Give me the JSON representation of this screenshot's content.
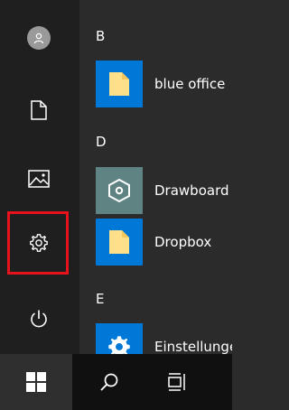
{
  "sidebar": {
    "items": [
      {
        "name": "account",
        "icon": "user-icon"
      },
      {
        "name": "documents",
        "icon": "document-icon"
      },
      {
        "name": "pictures",
        "icon": "pictures-icon"
      },
      {
        "name": "settings",
        "icon": "gear-icon",
        "highlighted": true
      },
      {
        "name": "power",
        "icon": "power-icon"
      }
    ]
  },
  "app_list": {
    "groups": [
      {
        "letter": "B",
        "apps": [
          {
            "label": "blue office",
            "icon": "folder-icon",
            "tile_color": "#0078d7"
          }
        ]
      },
      {
        "letter": "D",
        "apps": [
          {
            "label": "Drawboard",
            "icon": "drawboard-icon",
            "tile_color": "#5f8383"
          },
          {
            "label": "Dropbox",
            "icon": "folder-icon",
            "tile_color": "#0078d7"
          }
        ]
      },
      {
        "letter": "E",
        "apps": [
          {
            "label": "Einstellungen",
            "icon": "gear-icon",
            "tile_color": "#0078d7"
          }
        ]
      }
    ]
  },
  "taskbar": {
    "items": [
      {
        "name": "start",
        "icon": "windows-logo-icon"
      },
      {
        "name": "search",
        "icon": "search-icon"
      },
      {
        "name": "task-view",
        "icon": "task-view-icon"
      }
    ]
  },
  "colors": {
    "highlight": "#e8121c",
    "accent": "#0078d7",
    "folder": "#ffe08a"
  }
}
